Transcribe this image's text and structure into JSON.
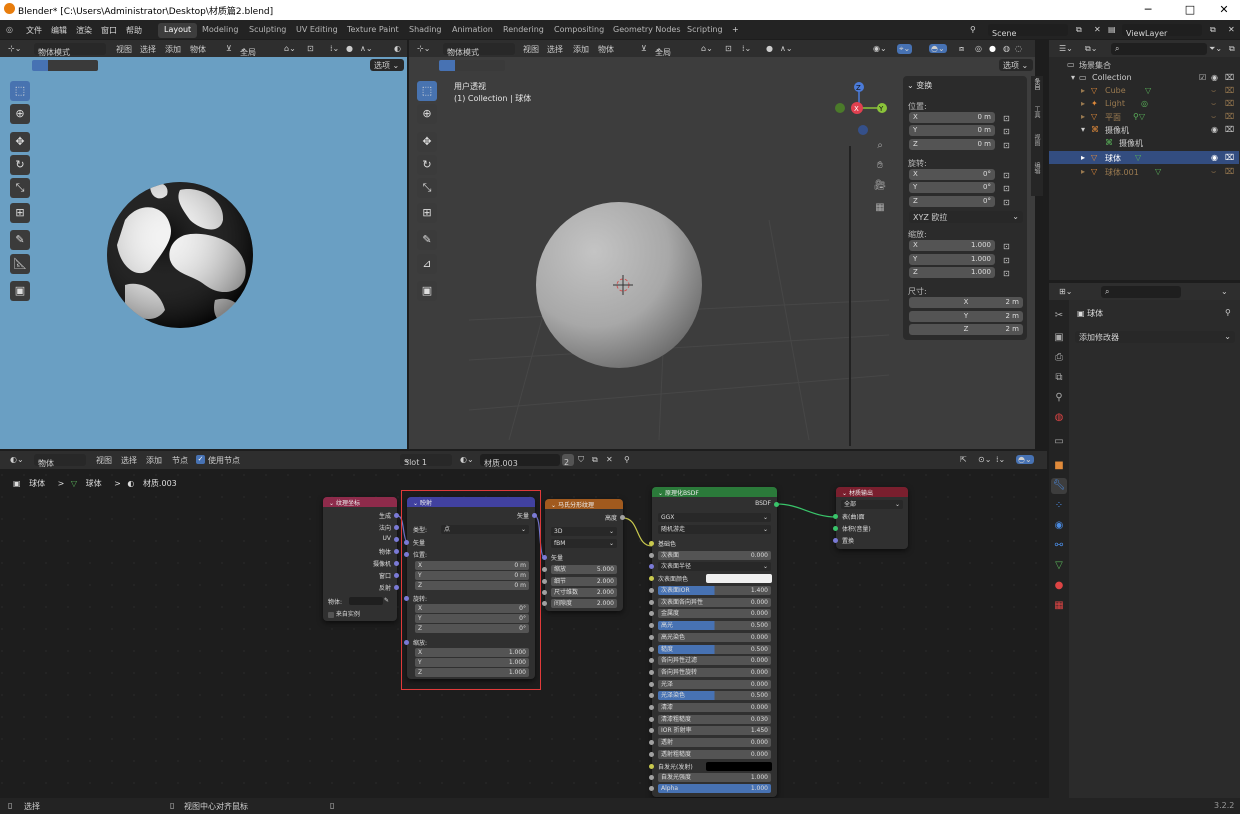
{
  "window": {
    "title": "Blender* [C:\\Users\\Administrator\\Desktop\\材质篇2.blend]"
  },
  "menu": [
    "文件",
    "编辑",
    "渲染",
    "窗口",
    "帮助"
  ],
  "workspaces": [
    "Layout",
    "Modeling",
    "Sculpting",
    "UV Editing",
    "Texture Paint",
    "Shading",
    "Animation",
    "Rendering",
    "Compositing",
    "Geometry Nodes",
    "Scripting"
  ],
  "workspace_add": "+",
  "scene": {
    "label": "Scene"
  },
  "viewlayer": {
    "label": "ViewLayer"
  },
  "left_view": {
    "mode": "物体模式",
    "menus": [
      "视图",
      "选择",
      "添加",
      "物体"
    ],
    "orientation": "全局",
    "options": "选项"
  },
  "main_view": {
    "mode": "物体模式",
    "menus": [
      "视图",
      "选择",
      "添加",
      "物体"
    ],
    "orientation": "全局",
    "options": "选项",
    "overlay_title": "用户透视",
    "overlay_sub": "(1) Collection | 球体",
    "gizmo": {
      "z": "Z",
      "y": "Y",
      "x": "X"
    }
  },
  "n_panel": {
    "section": "变换",
    "location_label": "位置:",
    "location": [
      {
        "axis": "X",
        "value": "0 m"
      },
      {
        "axis": "Y",
        "value": "0 m"
      },
      {
        "axis": "Z",
        "value": "0 m"
      }
    ],
    "rotation_label": "旋转:",
    "rotation": [
      {
        "axis": "X",
        "value": "0°"
      },
      {
        "axis": "Y",
        "value": "0°"
      },
      {
        "axis": "Z",
        "value": "0°"
      }
    ],
    "rotation_mode": "XYZ 欧拉",
    "scale_label": "缩放:",
    "scale": [
      {
        "axis": "X",
        "value": "1.000"
      },
      {
        "axis": "Y",
        "value": "1.000"
      },
      {
        "axis": "Z",
        "value": "1.000"
      }
    ],
    "dimensions_label": "尺寸:",
    "dimensions": [
      {
        "axis": "X",
        "value": "2 m"
      },
      {
        "axis": "Y",
        "value": "2 m"
      },
      {
        "axis": "Z",
        "value": "2 m"
      }
    ],
    "tabs": [
      "条目",
      "工具",
      "视图",
      "编辑"
    ]
  },
  "outliner": {
    "root": "场景集合",
    "items": [
      {
        "name": "Collection"
      },
      {
        "name": "Cube"
      },
      {
        "name": "Light"
      },
      {
        "name": "平面"
      },
      {
        "name": "摄像机"
      },
      {
        "name": "摄像机"
      },
      {
        "name": "球体"
      },
      {
        "name": "球体.001"
      }
    ]
  },
  "properties": {
    "object_name": "球体",
    "add_modifier": "添加修改器"
  },
  "node_editor": {
    "header": {
      "type": "物体",
      "menus": [
        "视图",
        "选择",
        "添加",
        "节点"
      ],
      "use_nodes": "使用节点",
      "slot": "Slot 1",
      "material": "材质.003",
      "users": "2"
    },
    "breadcrumb": [
      "球体",
      "球体",
      "材质.003"
    ]
  },
  "nodes": {
    "texcoord": {
      "title": "纹理坐标",
      "outputs": [
        "生成",
        "法向",
        "UV",
        "物体",
        "摄像机",
        "窗口",
        "反射"
      ],
      "object_label": "物体:",
      "from_instancer": "来自实例"
    },
    "mapping": {
      "title": "映射",
      "output": "矢量",
      "type_label": "类型:",
      "type_value": "点",
      "vector_label": "矢量",
      "location_label": "位置:",
      "location": [
        {
          "axis": "X",
          "value": "0 m"
        },
        {
          "axis": "Y",
          "value": "0 m"
        },
        {
          "axis": "Z",
          "value": "0 m"
        }
      ],
      "rotation_label": "旋转:",
      "rotation": [
        {
          "axis": "X",
          "value": "0°"
        },
        {
          "axis": "Y",
          "value": "0°"
        },
        {
          "axis": "Z",
          "value": "0°"
        }
      ],
      "scale_label": "缩放:",
      "scale": [
        {
          "axis": "X",
          "value": "1.000"
        },
        {
          "axis": "Y",
          "value": "1.000"
        },
        {
          "axis": "Z",
          "value": "1.000"
        }
      ]
    },
    "musgrave": {
      "title": "马氏分形纹理",
      "output": "高度",
      "dim": "3D",
      "kind": "fBM",
      "vector": "矢量",
      "fields": [
        {
          "label": "缩放",
          "value": "5.000"
        },
        {
          "label": "细节",
          "value": "2.000"
        },
        {
          "label": "尺寸维数",
          "value": "2.000"
        },
        {
          "label": "间隙度",
          "value": "2.000"
        }
      ]
    },
    "bsdf": {
      "title": "原理化BSDF",
      "output": "BSDF",
      "distribution": "GGX",
      "sss_method": "随机游走",
      "base_color": "基础色",
      "subsurface": {
        "label": "次表面",
        "value": "0.000"
      },
      "subsurface_radius": "次表面半径",
      "subsurface_color": "次表面颜色",
      "fields": [
        {
          "label": "次表面IOR",
          "value": "1.400",
          "fill": 0.5
        },
        {
          "label": "次表面各向异性",
          "value": "0.000",
          "fill": 0
        },
        {
          "label": "金属度",
          "value": "0.000",
          "fill": 0
        },
        {
          "label": "高光",
          "value": "0.500",
          "fill": 0.5
        },
        {
          "label": "高光染色",
          "value": "0.000",
          "fill": 0
        },
        {
          "label": "糙度",
          "value": "0.500",
          "fill": 0.5
        },
        {
          "label": "各向异性过滤",
          "value": "0.000",
          "fill": 0
        },
        {
          "label": "各向异性旋转",
          "value": "0.000",
          "fill": 0
        },
        {
          "label": "光泽",
          "value": "0.000",
          "fill": 0
        },
        {
          "label": "光泽染色",
          "value": "0.500",
          "fill": 0.5
        },
        {
          "label": "清漆",
          "value": "0.000",
          "fill": 0
        },
        {
          "label": "清漆粗糙度",
          "value": "0.030",
          "fill": 0
        },
        {
          "label": "IOR 折射率",
          "value": "1.450",
          "fill": 0
        },
        {
          "label": "透射",
          "value": "0.000",
          "fill": 0
        },
        {
          "label": "透射粗糙度",
          "value": "0.000",
          "fill": 0
        }
      ],
      "emission": "自发光(发射)",
      "emission_strength": {
        "label": "自发光强度",
        "value": "1.000"
      },
      "alpha": {
        "label": "Alpha",
        "value": "1.000",
        "fill": 1
      }
    },
    "output": {
      "title": "材质输出",
      "target": "全部",
      "inputs": [
        "表(曲)面",
        "体积(音量)",
        "置换"
      ]
    }
  },
  "status": {
    "left": "选择",
    "middle": "视图中心对齐鼠标",
    "version": "3.2.2"
  },
  "colors": {
    "accent": "#4772b3",
    "selection_box": "#e03a3a"
  }
}
